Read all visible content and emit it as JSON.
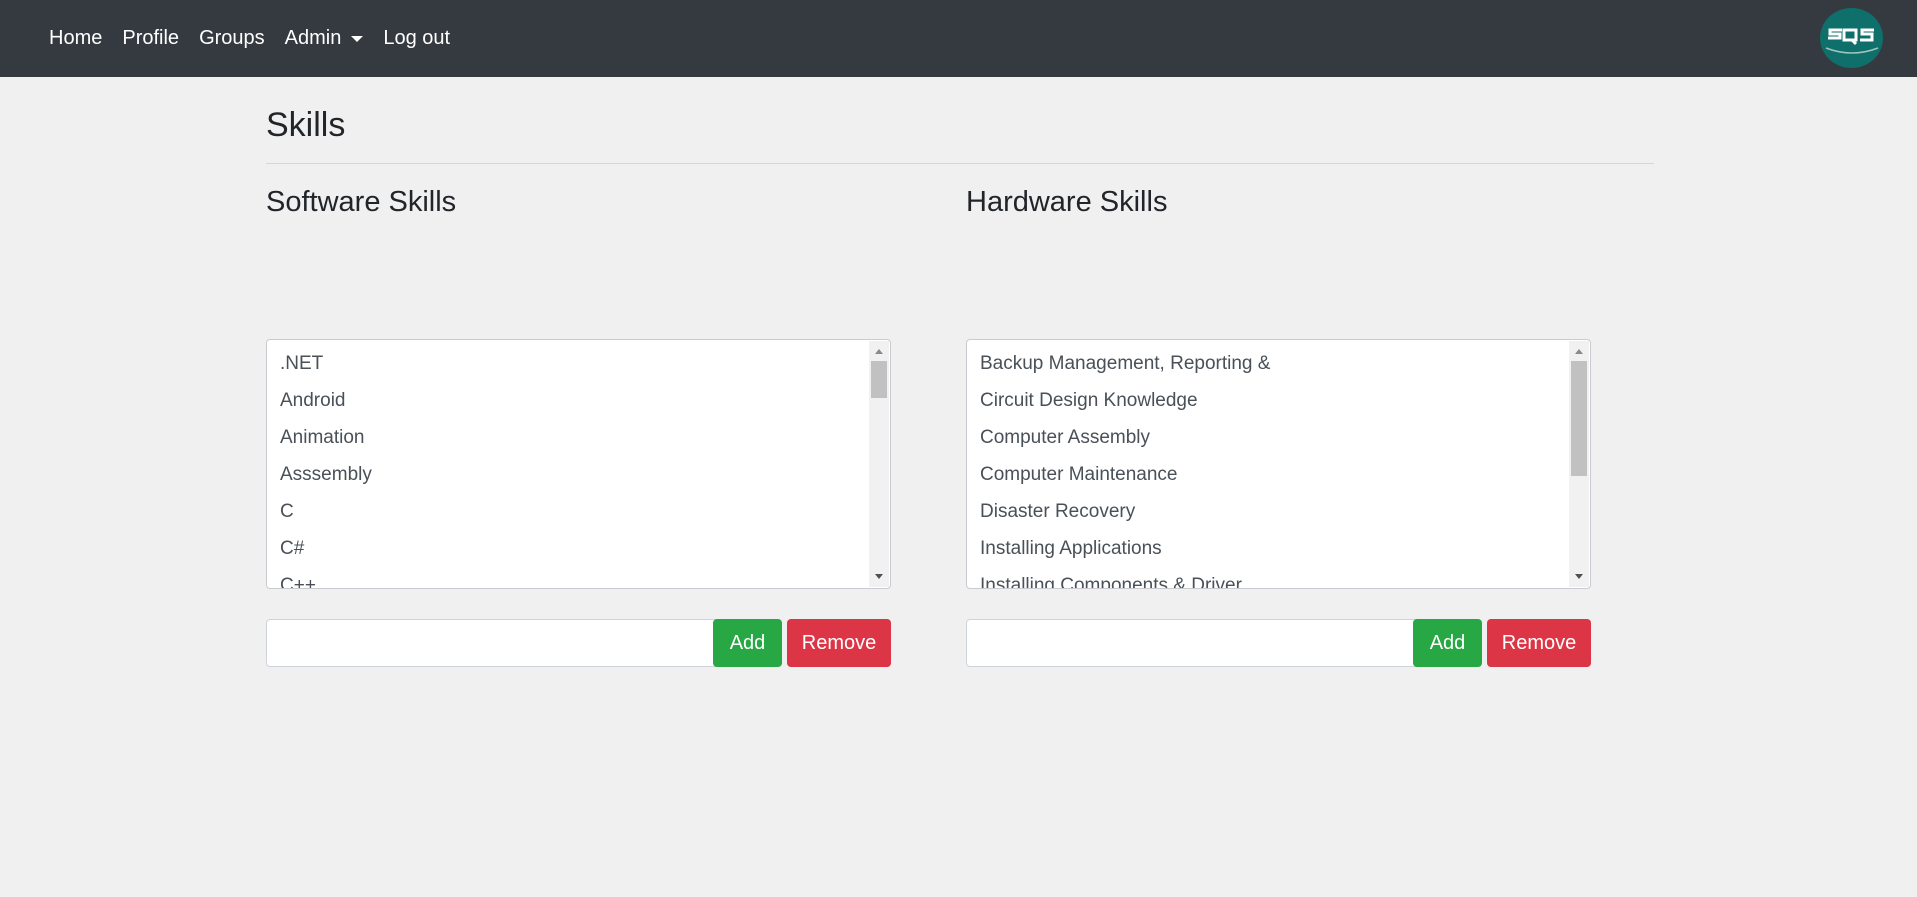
{
  "nav": {
    "links": [
      "Home",
      "Profile",
      "Groups",
      "Admin",
      "Log out"
    ],
    "logo_text": "SQS",
    "colors": {
      "background": "#343a40",
      "logo": "#0f6f6a"
    }
  },
  "page": {
    "title": "Skills"
  },
  "software": {
    "title": "Software Skills",
    "items": [
      ".NET",
      "Android",
      "Animation",
      "Asssembly",
      "C",
      "C#",
      "C++"
    ],
    "input_value": "",
    "add_label": "Add",
    "remove_label": "Remove"
  },
  "hardware": {
    "title": "Hardware Skills",
    "items": [
      "Backup Management, Reporting &",
      "Circuit Design Knowledge",
      "Computer Assembly",
      "Computer Maintenance",
      "Disaster Recovery",
      "Installing Applications",
      "Installing Components & Driver"
    ],
    "input_value": "",
    "add_label": "Add",
    "remove_label": "Remove"
  },
  "colors": {
    "add": "#28a745",
    "remove": "#dc3545"
  }
}
